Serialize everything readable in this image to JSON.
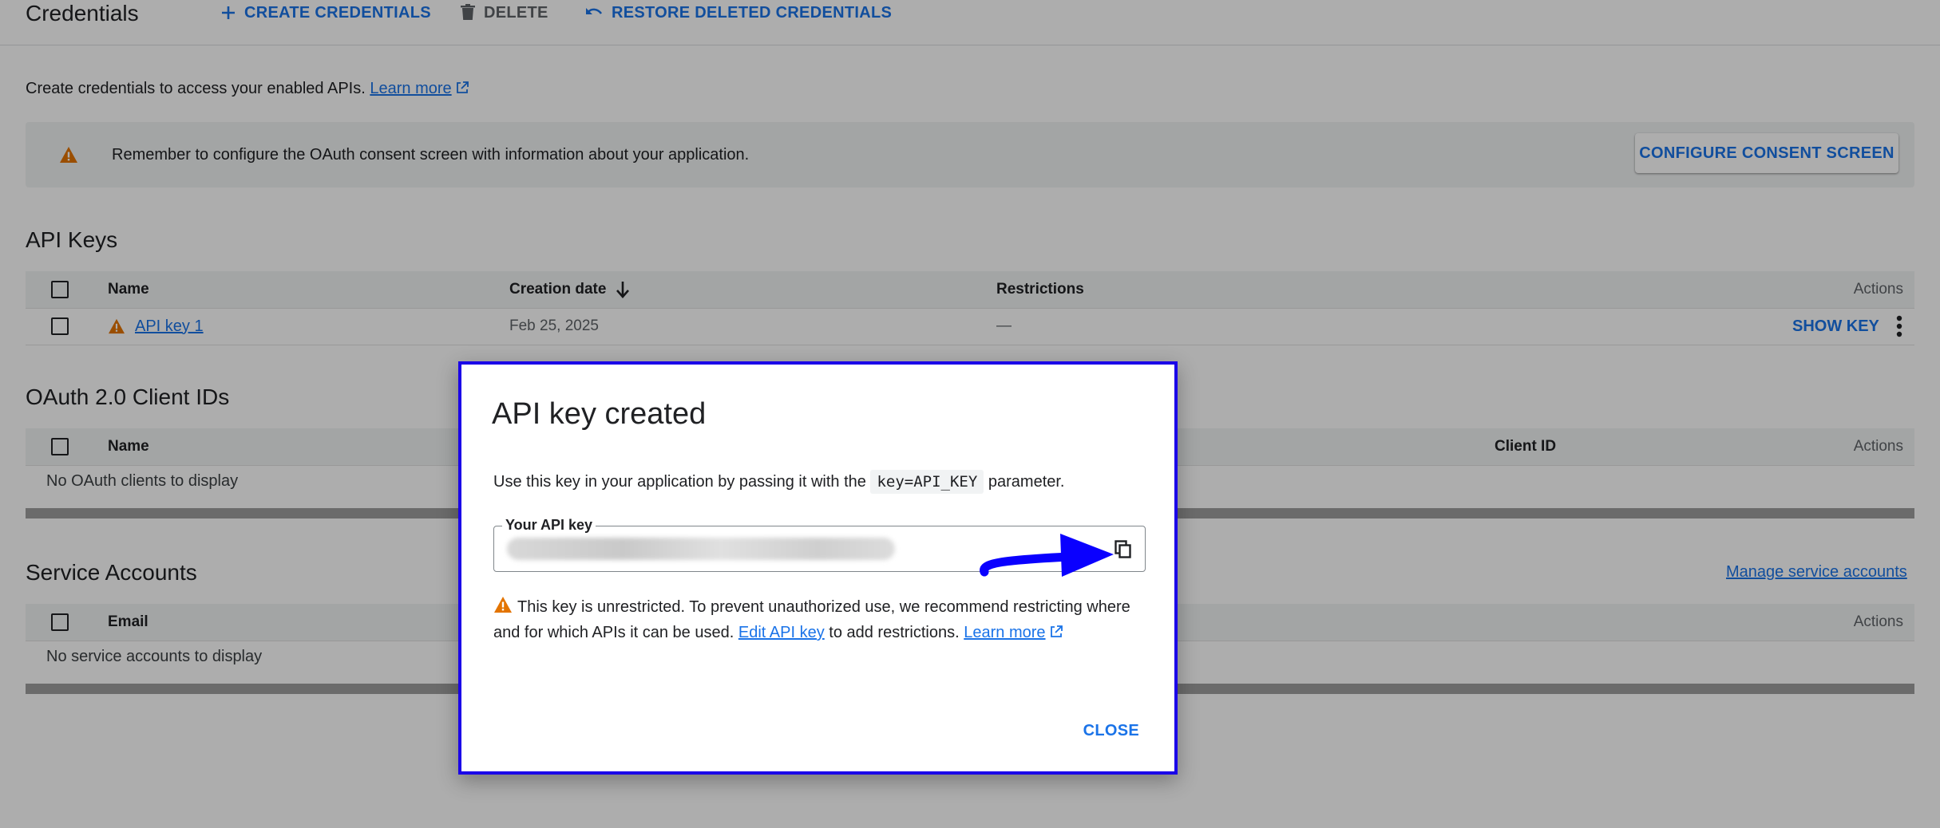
{
  "toolbar": {
    "title": "Credentials",
    "create_label": "CREATE CREDENTIALS",
    "delete_label": "DELETE",
    "restore_label": "RESTORE DELETED CREDENTIALS"
  },
  "intro": {
    "text": "Create credentials to access your enabled APIs.",
    "learn_more": "Learn more"
  },
  "banner": {
    "message": "Remember to configure the OAuth consent screen with information about your application.",
    "button": "CONFIGURE CONSENT SCREEN"
  },
  "api_keys": {
    "title": "API Keys",
    "columns": {
      "name": "Name",
      "created": "Creation date",
      "restrictions": "Restrictions",
      "actions": "Actions"
    },
    "rows": [
      {
        "name": "API key 1",
        "created": "Feb 25, 2025",
        "restrictions": "—",
        "action": "SHOW KEY"
      }
    ]
  },
  "oauth": {
    "title": "OAuth 2.0 Client IDs",
    "columns": {
      "name": "Name",
      "client_id": "Client ID",
      "actions": "Actions"
    },
    "empty": "No OAuth clients to display"
  },
  "service_accounts": {
    "title": "Service Accounts",
    "manage_link": "Manage service accounts",
    "columns": {
      "email": "Email",
      "actions": "Actions"
    },
    "empty": "No service accounts to display"
  },
  "dialog": {
    "title": "API key created",
    "desc_before": "Use this key in your application by passing it with the",
    "desc_code": "key=API_KEY",
    "desc_after": "parameter.",
    "key_legend": "Your API key",
    "warn_text": "This key is unrestricted. To prevent unauthorized use, we recommend restricting where and for which APIs it can be used.",
    "edit_link": "Edit API key",
    "warn_after": "to add restrictions.",
    "learn_more": "Learn more",
    "close": "CLOSE"
  },
  "colors": {
    "accent": "#1a73e8",
    "warning": "#e37400",
    "dialog_border": "#1a00e8",
    "arrow": "#0a00ff"
  }
}
